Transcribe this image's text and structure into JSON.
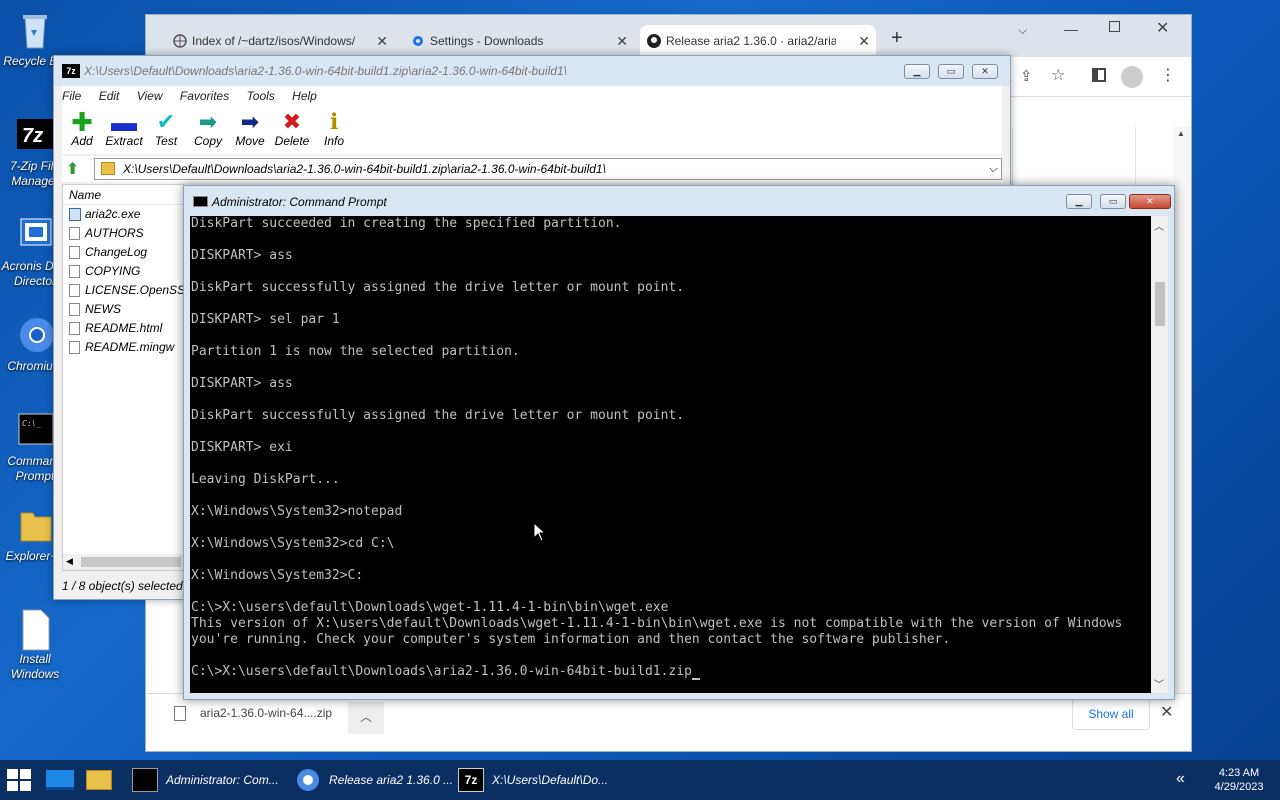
{
  "desktop": {
    "icons": [
      {
        "label": "Recycle Bin"
      },
      {
        "label": "7-Zip File Manager"
      },
      {
        "label": "Acronis Disk Director"
      },
      {
        "label": "Chromium"
      },
      {
        "label": "Command Prompt"
      },
      {
        "label": "Explorer++"
      },
      {
        "label": "Install Windows"
      }
    ]
  },
  "browser": {
    "tabs": [
      {
        "label": "Index of /~dartz/isos/Windows/"
      },
      {
        "label": "Settings - Downloads"
      },
      {
        "label": "Release aria2 1.36.0 · aria2/aria2"
      }
    ],
    "new_tab": "+",
    "download": {
      "filename": "aria2-1.36.0-win-64....zip",
      "show_all": "Show all"
    }
  },
  "zip": {
    "title": "X:\\Users\\Default\\Downloads\\aria2-1.36.0-win-64bit-build1.zip\\aria2-1.36.0-win-64bit-build1\\",
    "menu": [
      "File",
      "Edit",
      "View",
      "Favorites",
      "Tools",
      "Help"
    ],
    "toolbar": [
      {
        "label": "Add",
        "icon": "plus-icon"
      },
      {
        "label": "Extract",
        "icon": "minus-icon"
      },
      {
        "label": "Test",
        "icon": "check-icon"
      },
      {
        "label": "Copy",
        "icon": "arrow-right-icon"
      },
      {
        "label": "Move",
        "icon": "arrow-right-icon"
      },
      {
        "label": "Delete",
        "icon": "x-icon"
      },
      {
        "label": "Info",
        "icon": "info-icon"
      }
    ],
    "address": "X:\\Users\\Default\\Downloads\\aria2-1.36.0-win-64bit-build1.zip\\aria2-1.36.0-win-64bit-build1\\",
    "column_name": "Name",
    "files": [
      "aria2c.exe",
      "AUTHORS",
      "ChangeLog",
      "COPYING",
      "LICENSE.OpenSSL",
      "NEWS",
      "README.html",
      "README.mingw"
    ],
    "status": "1 / 8 object(s) selected"
  },
  "cmd": {
    "title": "Administrator: Command Prompt",
    "lines": [
      "DiskPart succeeded in creating the specified partition.",
      "",
      "DISKPART> ass",
      "",
      "DiskPart successfully assigned the drive letter or mount point.",
      "",
      "DISKPART> sel par 1",
      "",
      "Partition 1 is now the selected partition.",
      "",
      "DISKPART> ass",
      "",
      "DiskPart successfully assigned the drive letter or mount point.",
      "",
      "DISKPART> exi",
      "",
      "Leaving DiskPart...",
      "",
      "X:\\Windows\\System32>notepad",
      "",
      "X:\\Windows\\System32>cd C:\\",
      "",
      "X:\\Windows\\System32>C:",
      "",
      "C:\\>X:\\users\\default\\Downloads\\wget-1.11.4-1-bin\\bin\\wget.exe",
      "This version of X:\\users\\default\\Downloads\\wget-1.11.4-1-bin\\bin\\wget.exe is not compatible with the version of Windows",
      "you're running. Check your computer's system information and then contact the software publisher.",
      "",
      "C:\\>X:\\users\\default\\Downloads\\aria2-1.36.0-win-64bit-build1.zip"
    ]
  },
  "taskbar": {
    "items": [
      {
        "label": "Administrator: Com..."
      },
      {
        "label": "Release aria2 1.36.0 ..."
      },
      {
        "label": "X:\\Users\\Default\\Do..."
      }
    ],
    "time": "4:23 AM",
    "date": "4/29/2023"
  }
}
